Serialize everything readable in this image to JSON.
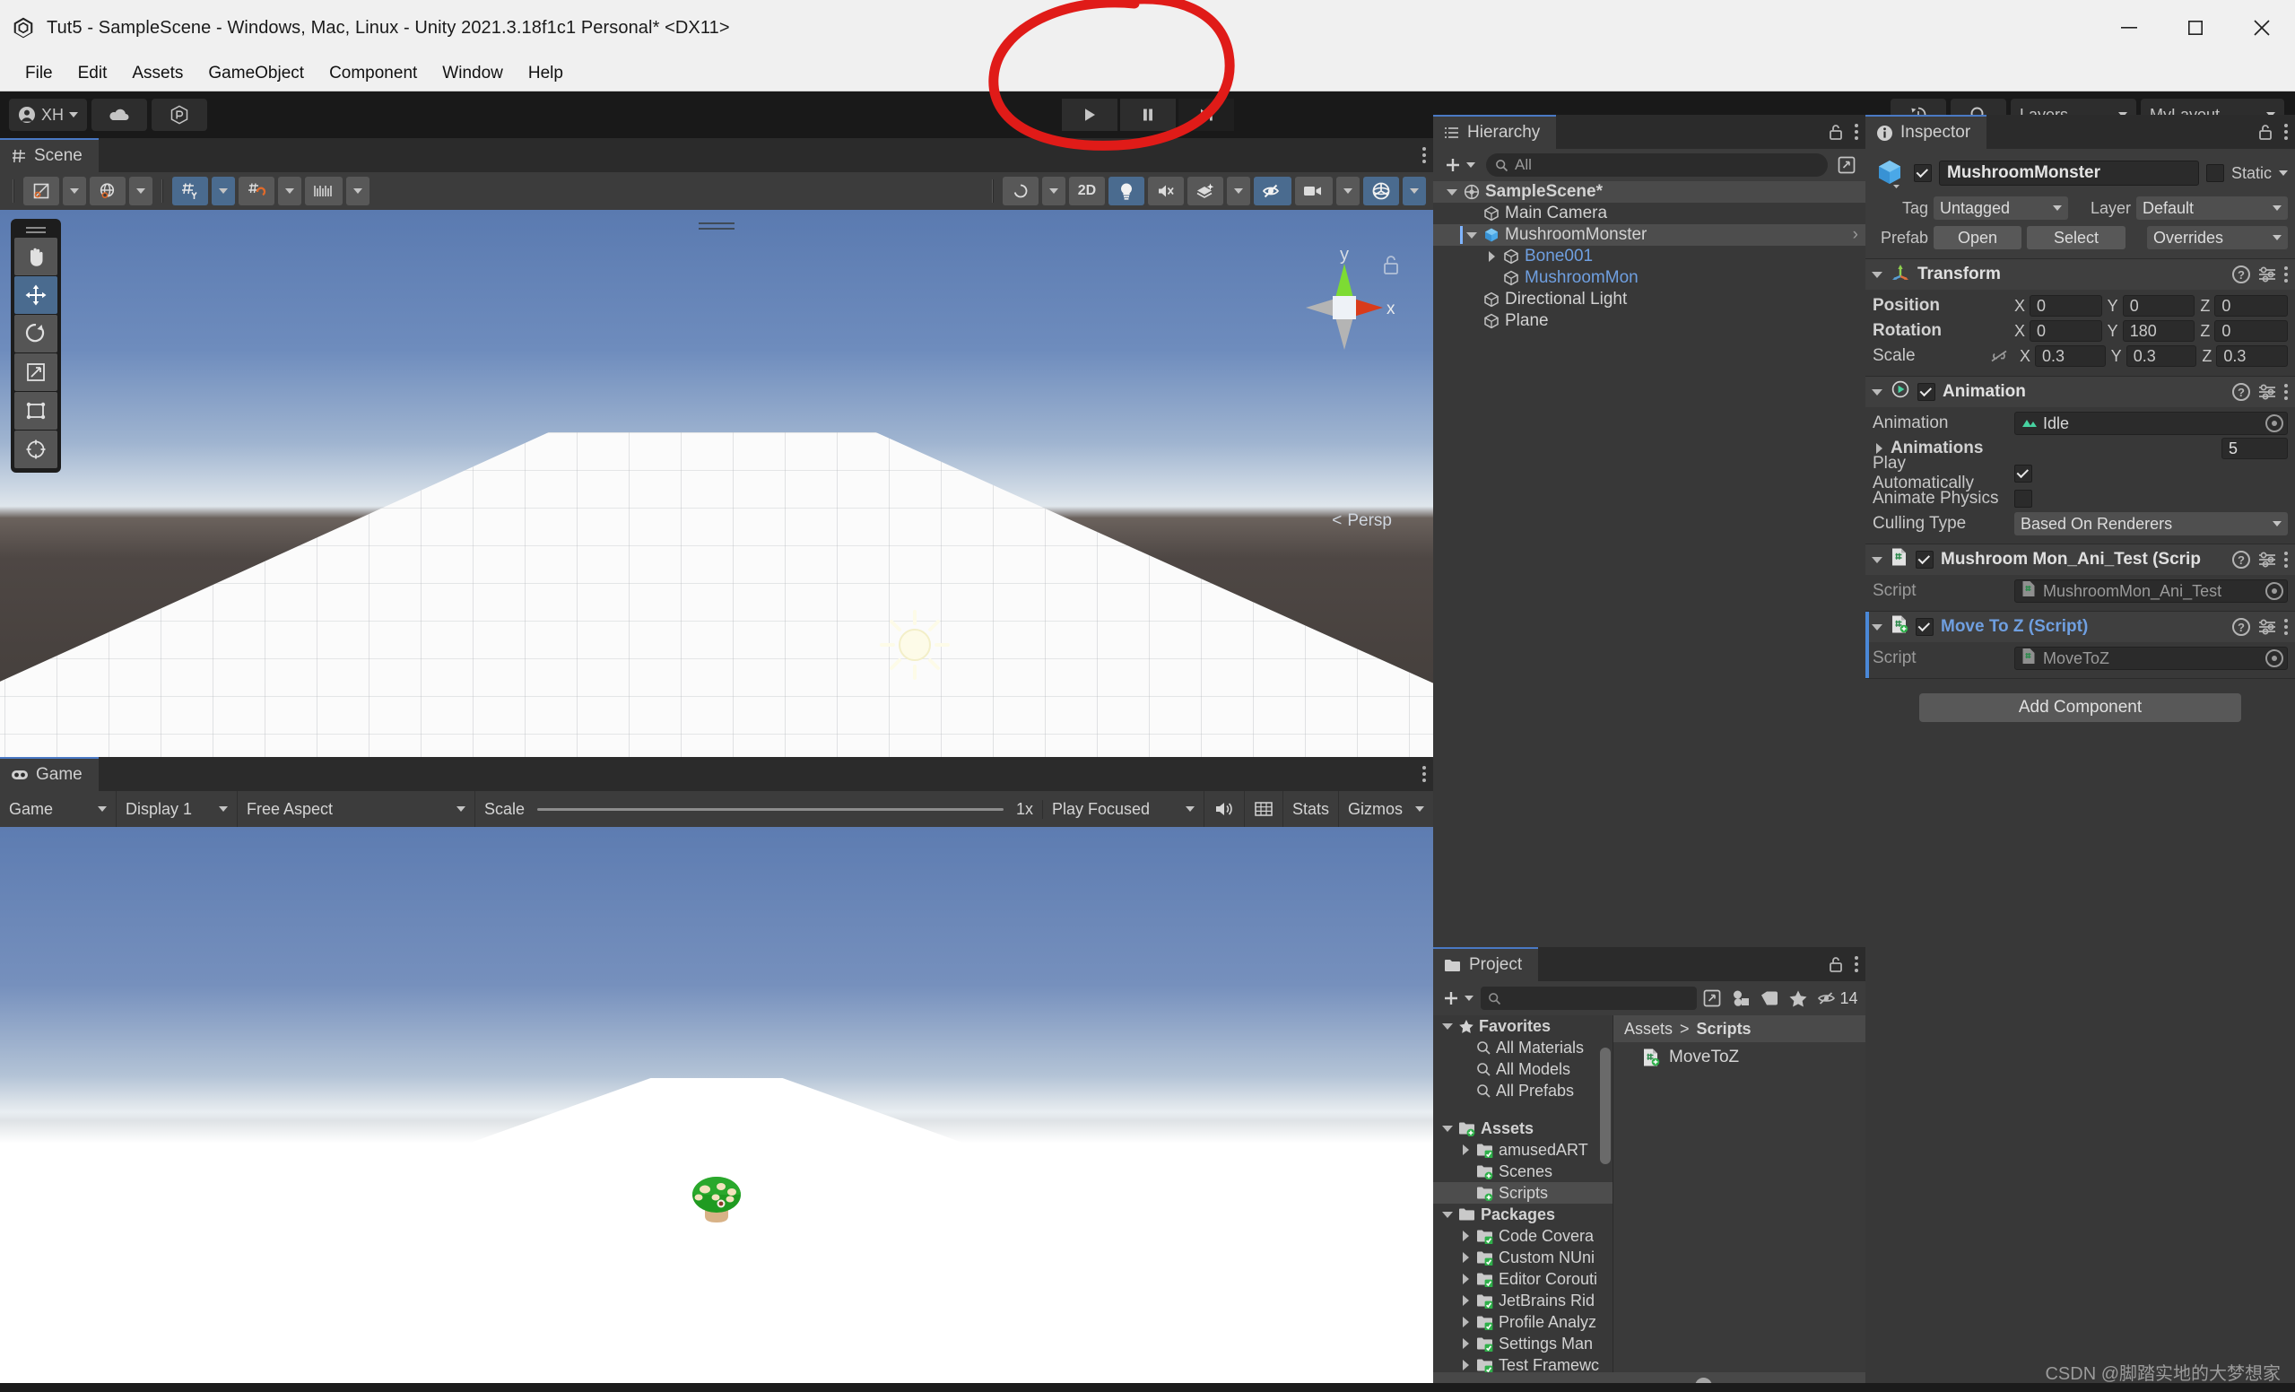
{
  "window": {
    "title": "Tut5 - SampleScene - Windows, Mac, Linux - Unity 2021.3.18f1c1 Personal* <DX11>",
    "minimize": "minimize-icon",
    "maximize": "maximize-icon",
    "close": "close-icon"
  },
  "menu": {
    "items": [
      "File",
      "Edit",
      "Assets",
      "GameObject",
      "Component",
      "Window",
      "Help"
    ]
  },
  "toolbar": {
    "account_label": "XH",
    "cloud_label": "cloud-icon",
    "services_label": "services-icon",
    "play": "play-icon",
    "pause": "pause-icon",
    "step": "step-icon",
    "undo_history": "history-icon",
    "search": "search-icon",
    "layers": "Layers",
    "layout": "MyLayout"
  },
  "scene": {
    "tab_label": "Scene",
    "tools": [
      "hand-tool",
      "move-tool",
      "rotate-tool",
      "scale-tool",
      "rect-tool",
      "transform-tool"
    ],
    "toolbar_left": [
      "pivot-center-toggle",
      "global-local-toggle",
      "grid-axis-y",
      "grid-snap",
      "snap-increment"
    ],
    "toolbar_right": [
      "scene-camera-mode",
      "2D",
      "lighting-toggle",
      "audio-toggle",
      "fx-toggle",
      "hidden-objects-toggle",
      "camera-gizmos",
      "scene-gizmos"
    ],
    "twod_label": "2D",
    "persp_label": "Persp",
    "gizmo_axes": {
      "x": "x",
      "y": "y"
    }
  },
  "game": {
    "tab_label": "Game",
    "view_mode": "Game",
    "display": "Display 1",
    "aspect": "Free Aspect",
    "scale_label": "Scale",
    "scale_value": "1x",
    "play_mode": "Play Focused",
    "mute_label": "mute-audio-icon",
    "grid_label": "pixel-perfect-icon",
    "stats": "Stats",
    "gizmos": "Gizmos"
  },
  "hierarchy": {
    "tab_label": "Hierarchy",
    "search_placeholder": "All",
    "create_label": "create-button",
    "items": [
      {
        "label": "SampleScene*",
        "depth": 0,
        "icon": "scene-icon",
        "expanded": true,
        "selected": false,
        "style": "scene"
      },
      {
        "label": "Main Camera",
        "depth": 1,
        "icon": "gameobject-icon",
        "expanded": null,
        "selected": false,
        "style": "normal"
      },
      {
        "label": "MushroomMonster",
        "depth": 1,
        "icon": "prefab-icon",
        "expanded": true,
        "selected": true,
        "style": "normal"
      },
      {
        "label": "Bone001",
        "depth": 2,
        "icon": "gameobject-icon",
        "expanded": false,
        "selected": false,
        "style": "blue"
      },
      {
        "label": "MushroomMon",
        "depth": 2,
        "icon": "gameobject-icon",
        "expanded": null,
        "selected": false,
        "style": "blue"
      },
      {
        "label": "Directional Light",
        "depth": 1,
        "icon": "gameobject-icon",
        "expanded": null,
        "selected": false,
        "style": "normal"
      },
      {
        "label": "Plane",
        "depth": 1,
        "icon": "gameobject-icon",
        "expanded": null,
        "selected": false,
        "style": "normal"
      }
    ]
  },
  "project": {
    "tab_label": "Project",
    "search_placeholder": "",
    "hidden_count": "14",
    "breadcrumb": [
      "Assets",
      "Scripts"
    ],
    "tree": [
      {
        "label": "Favorites",
        "depth": 0,
        "icon": "star-icon",
        "expanded": true,
        "bold": true
      },
      {
        "label": "All Materials",
        "depth": 1,
        "icon": "search-icon",
        "expanded": null,
        "bold": false
      },
      {
        "label": "All Models",
        "depth": 1,
        "icon": "search-icon",
        "expanded": null,
        "bold": false
      },
      {
        "label": "All Prefabs",
        "depth": 1,
        "icon": "search-icon",
        "expanded": null,
        "bold": false
      },
      {
        "label": "",
        "depth": 0,
        "icon": "spacer",
        "expanded": null,
        "bold": false
      },
      {
        "label": "Assets",
        "depth": 0,
        "icon": "folder-icon",
        "expanded": true,
        "bold": true
      },
      {
        "label": "amusedART",
        "depth": 1,
        "icon": "folder-icon",
        "expanded": false,
        "bold": false
      },
      {
        "label": "Scenes",
        "depth": 1,
        "icon": "folder-icon",
        "expanded": null,
        "bold": false
      },
      {
        "label": "Scripts",
        "depth": 1,
        "icon": "folder-icon",
        "expanded": null,
        "bold": false,
        "selected": true
      },
      {
        "label": "Packages",
        "depth": 0,
        "icon": "folder-icon",
        "expanded": true,
        "bold": true
      },
      {
        "label": "Code Covera",
        "depth": 1,
        "icon": "folder-icon",
        "expanded": false,
        "bold": false
      },
      {
        "label": "Custom NUni",
        "depth": 1,
        "icon": "folder-icon",
        "expanded": false,
        "bold": false
      },
      {
        "label": "Editor Corouti",
        "depth": 1,
        "icon": "folder-icon",
        "expanded": false,
        "bold": false
      },
      {
        "label": "JetBrains Rid",
        "depth": 1,
        "icon": "folder-icon",
        "expanded": false,
        "bold": false
      },
      {
        "label": "Profile Analyz",
        "depth": 1,
        "icon": "folder-icon",
        "expanded": false,
        "bold": false
      },
      {
        "label": "Settings Man",
        "depth": 1,
        "icon": "folder-icon",
        "expanded": false,
        "bold": false
      },
      {
        "label": "Test Framewc",
        "depth": 1,
        "icon": "folder-icon",
        "expanded": false,
        "bold": false
      }
    ],
    "files": [
      {
        "label": "MoveToZ",
        "icon": "cs-script-icon"
      }
    ]
  },
  "inspector": {
    "tab_label": "Inspector",
    "object_name": "MushroomMonster",
    "enabled": true,
    "static_label": "Static",
    "tag_label": "Tag",
    "tag_value": "Untagged",
    "layer_label": "Layer",
    "layer_value": "Default",
    "prefab_label": "Prefab",
    "prefab_open": "Open",
    "prefab_select": "Select",
    "prefab_overrides": "Overrides",
    "components": [
      {
        "name": "Transform",
        "icon": "transform-icon",
        "has_checkbox": false,
        "selected": false,
        "rows": [
          {
            "label": "Position",
            "type": "vector3",
            "x": "0",
            "y": "0",
            "z": "0",
            "bold": true
          },
          {
            "label": "Rotation",
            "type": "vector3",
            "x": "0",
            "y": "180",
            "z": "0",
            "bold": true
          },
          {
            "label": "Scale",
            "type": "vector3",
            "x": "0.3",
            "y": "0.3",
            "z": "0.3",
            "bold": false,
            "link_icon": "constrain-proportions-off-icon"
          }
        ]
      },
      {
        "name": "Animation",
        "icon": "animation-icon",
        "has_checkbox": true,
        "enabled": true,
        "selected": false,
        "rows": [
          {
            "label": "Animation",
            "type": "object",
            "value": "Idle",
            "value_icon": "animation-clip-icon"
          },
          {
            "label": "Animations",
            "type": "array",
            "value": "5",
            "bold": true,
            "expanded": false
          },
          {
            "label": "Play Automatically",
            "type": "checkbox",
            "checked": true
          },
          {
            "label": "Animate Physics",
            "type": "checkbox",
            "checked": false
          },
          {
            "label": "Culling Type",
            "type": "dropdown",
            "value": "Based On Renderers"
          }
        ]
      },
      {
        "name": "Mushroom Mon_Ani_Test (Scrip",
        "icon": "cs-script-icon",
        "has_checkbox": true,
        "enabled": true,
        "selected": false,
        "rows": [
          {
            "label": "Script",
            "type": "object-readonly",
            "value": "MushroomMon_Ani_Test"
          }
        ]
      },
      {
        "name": "Move To Z (Script)",
        "icon": "cs-script-icon",
        "has_checkbox": true,
        "enabled": true,
        "selected": true,
        "title_blue": true,
        "rows": [
          {
            "label": "Script",
            "type": "object-readonly",
            "value": "MoveToZ"
          }
        ]
      }
    ],
    "add_component": "Add Component"
  },
  "annotation": {
    "shape": "red-circle-highlight",
    "color": "#e01b18"
  },
  "watermark": "CSDN @脚踏实地的大梦想家"
}
